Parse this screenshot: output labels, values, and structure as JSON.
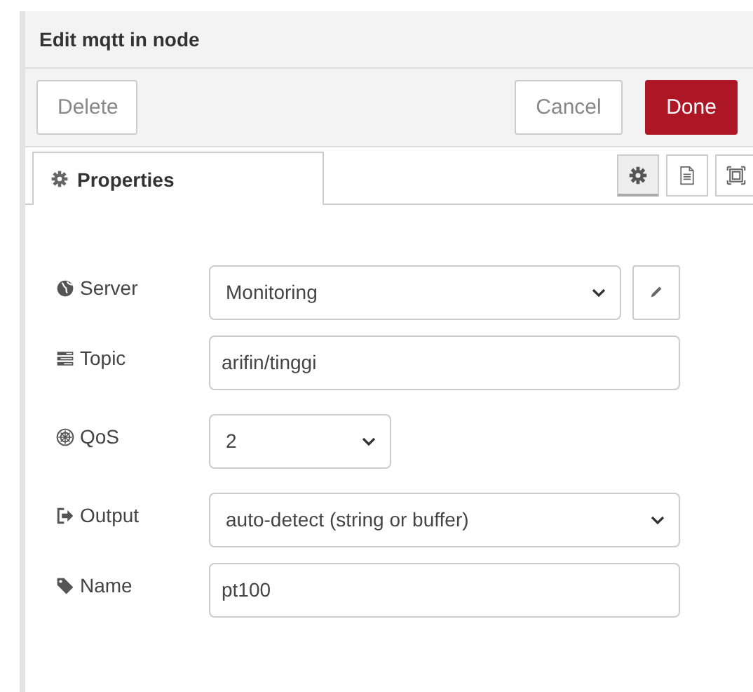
{
  "window": {
    "title": "Edit mqtt in node"
  },
  "buttons": [
    {
      "label": "Delete",
      "kind": "plain"
    },
    {
      "label": "Cancel",
      "kind": "plain"
    },
    {
      "label": "Done",
      "kind": "primary"
    }
  ],
  "tabs": [
    {
      "label": "Properties",
      "selected": true
    }
  ],
  "side_tabs": [
    {
      "kind": "gear",
      "selected": true
    },
    {
      "kind": "document",
      "selected": false
    },
    {
      "kind": "frame",
      "selected": false
    }
  ],
  "fields": [
    {
      "label": "Server",
      "kind": "select_with_edit",
      "value": "Monitoring"
    },
    {
      "label": "Topic",
      "kind": "input",
      "value": "arifin/tinggi"
    },
    {
      "label": "QoS",
      "kind": "select_short",
      "value": "2"
    },
    {
      "label": "Output",
      "kind": "select",
      "value": "auto-detect (string or buffer)"
    },
    {
      "label": "Name",
      "kind": "input",
      "value": "pt100"
    }
  ]
}
